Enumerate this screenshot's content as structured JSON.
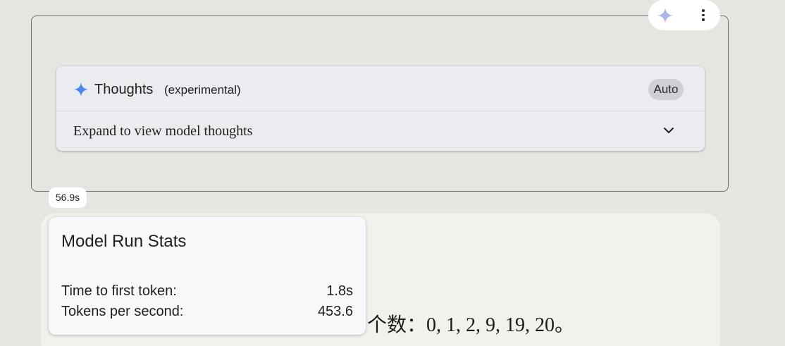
{
  "thoughts": {
    "title": "Thoughts",
    "subtitle": "(experimental)",
    "mode_chip": "Auto",
    "expand_label": "Expand to view model thoughts"
  },
  "timing_badge": "56.9s",
  "run_stats": {
    "title": "Model Run Stats",
    "rows": [
      {
        "label": "Time to first token:",
        "value": "1.8s"
      },
      {
        "label": "Tokens per second:",
        "value": "453.6"
      }
    ]
  },
  "response": {
    "visible_text": "个数：0, 1, 2, 9, 19, 20。"
  },
  "icons": {
    "spark_color": "#4d86ef",
    "pill_spark_color": "#a9b8e4",
    "kebab": "more-vert-icon",
    "chevron": "chevron-down-icon"
  },
  "colors": {
    "background": "#e6e5e0",
    "thoughts_panel": "#ebecf0",
    "response_card": "#f2f1ec",
    "chip_bg": "#cfd0d4"
  }
}
